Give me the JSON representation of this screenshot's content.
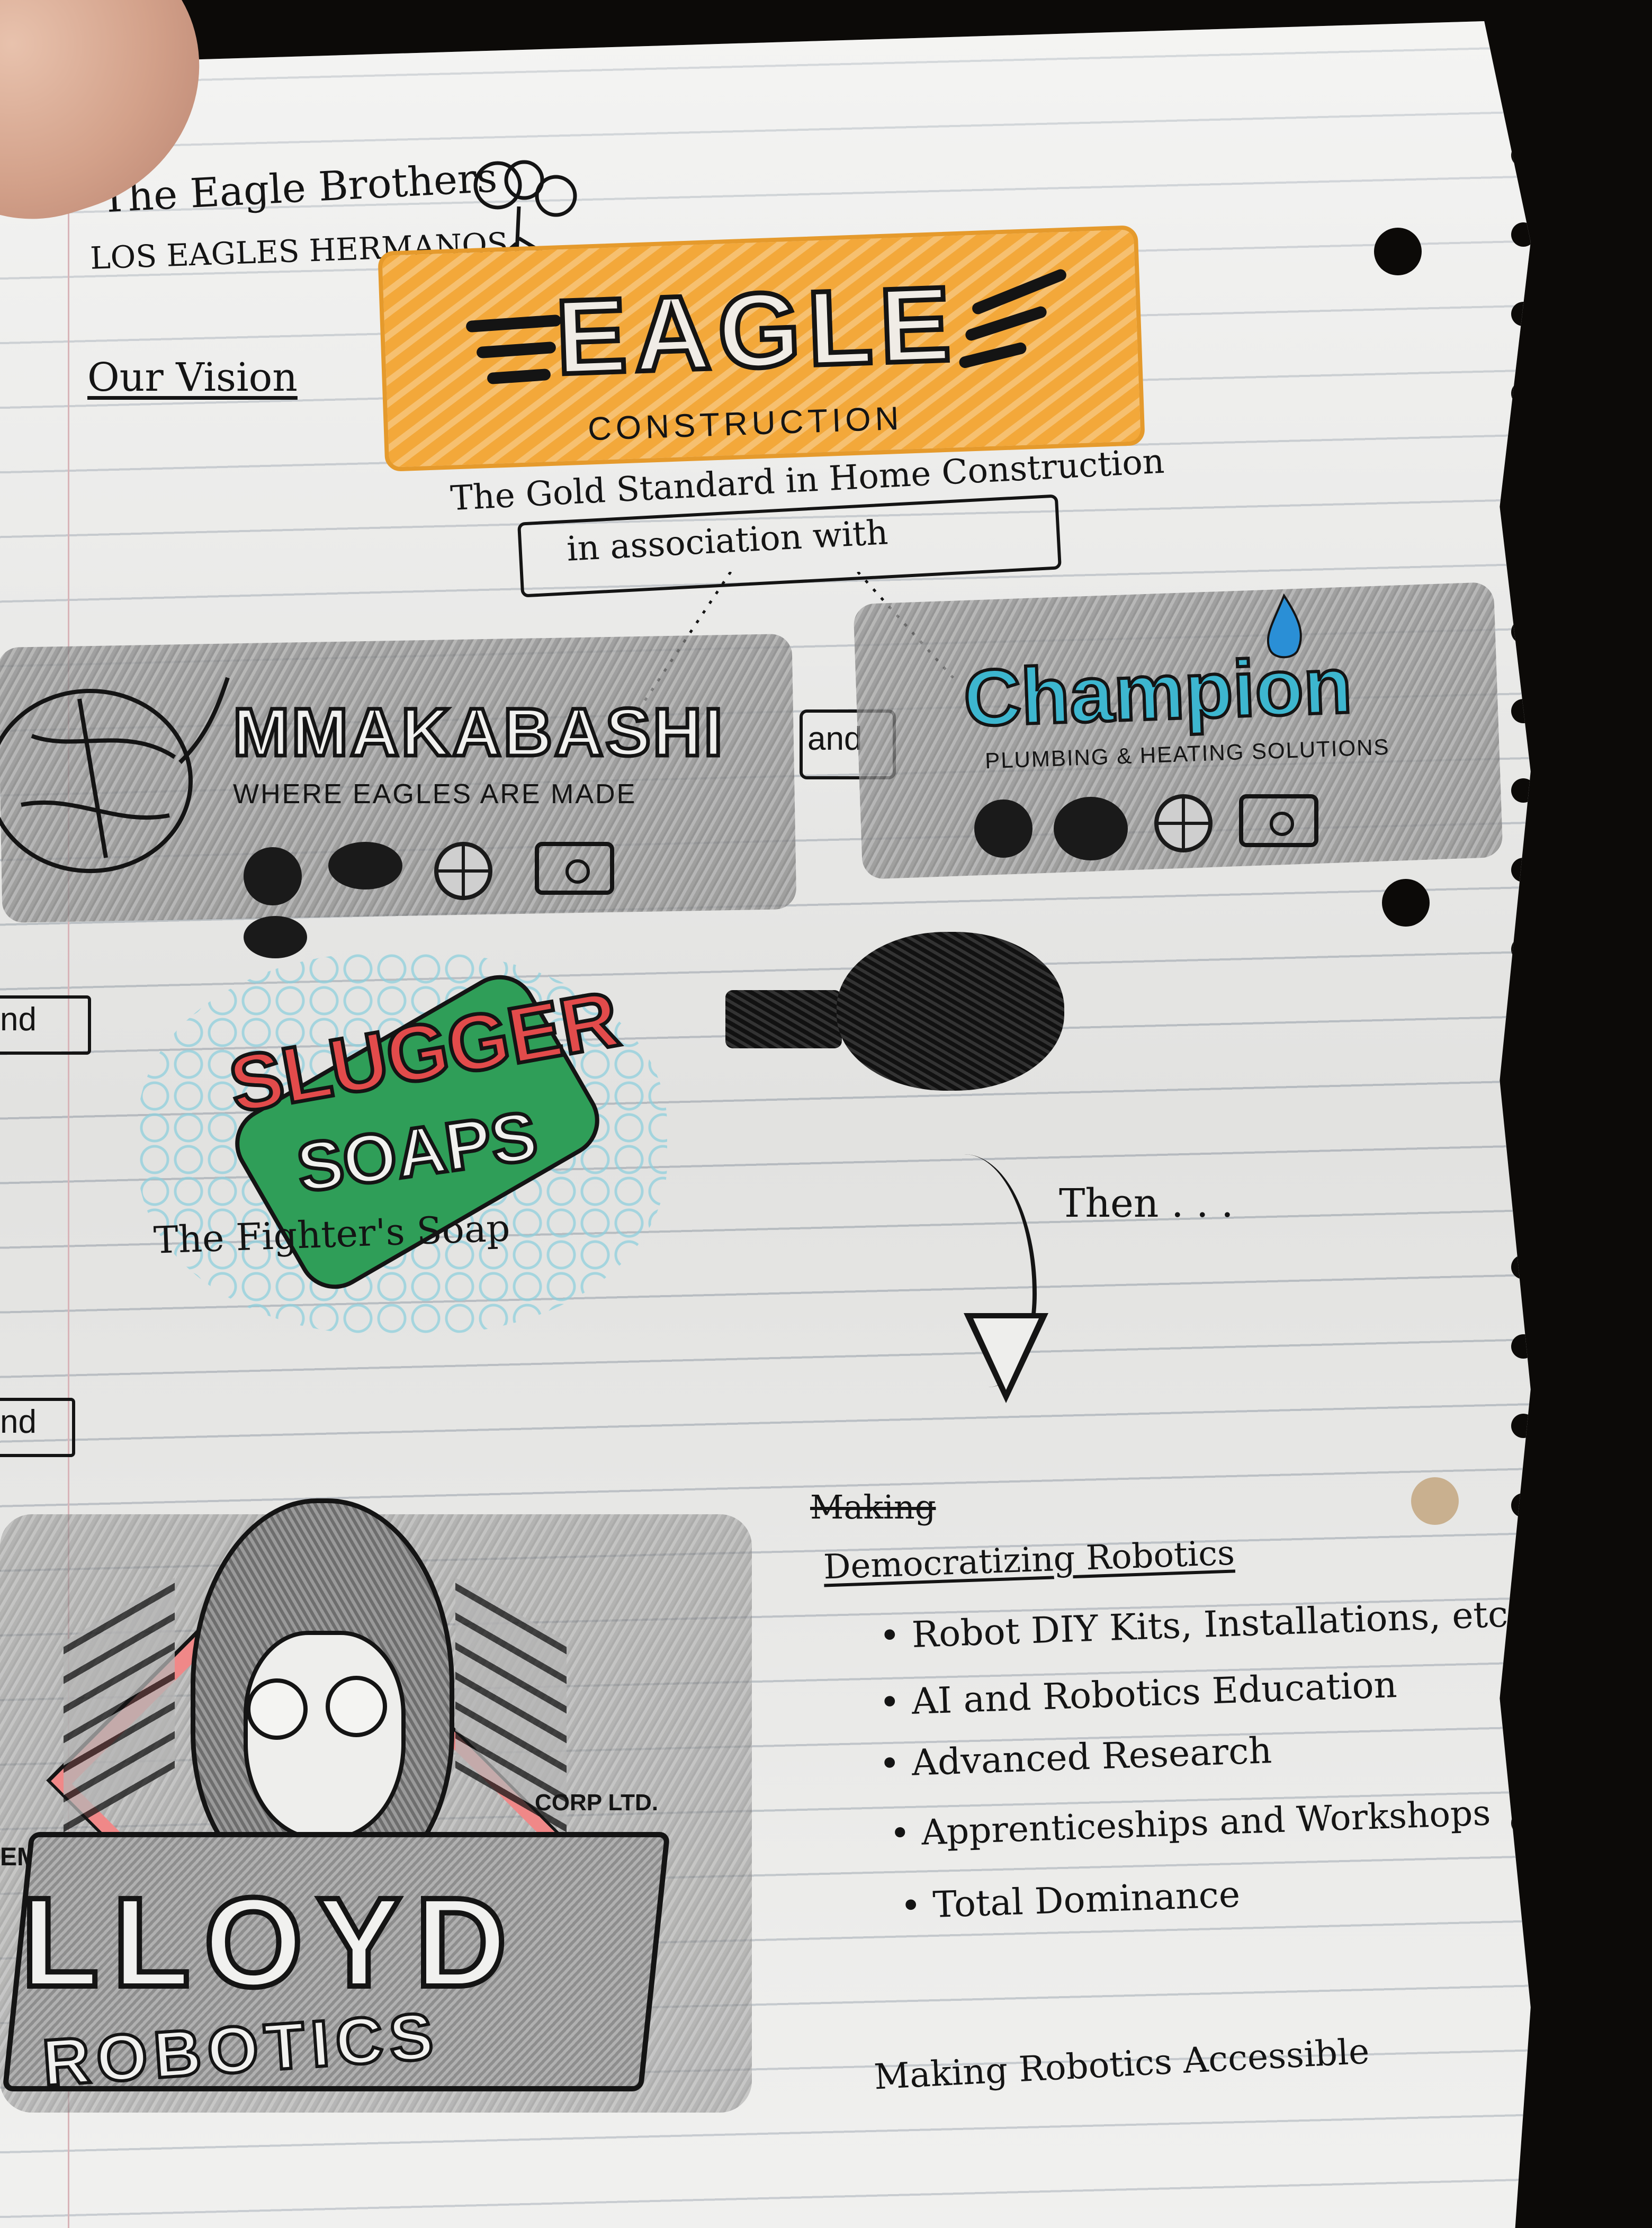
{
  "header": {
    "line1": "The Eagle Brothers",
    "line2": "LOS EAGLES HERMANOS",
    "vision_label": "Our Vision"
  },
  "eagle": {
    "name": "EAGLE",
    "sub": "CONSTRUCTION",
    "tagline": "The Gold Standard in Home Construction",
    "association": "in association with"
  },
  "mmakabashi": {
    "name": "MMAKABASHI",
    "tagline": "WHERE EAGLES ARE MADE"
  },
  "connector": "and",
  "champion": {
    "name": "Champion",
    "tagline": "PLUMBING & HEATING SOLUTIONS",
    "name_color": "#3db6cf",
    "flame_color": "#2a8fd6"
  },
  "and_left_1": "nd",
  "and_left_2": "nd",
  "slugger": {
    "name_top": "SLUGGER",
    "name_bottom": "SOAPS",
    "tagline": "The Fighter's Soap",
    "red": "#e24b4b",
    "green": "#2f9e58"
  },
  "then": "Then . . .",
  "lloyd": {
    "empire": "EMPIRE",
    "corp": "CORP LTD.",
    "name": "LLOYD",
    "robotics": "ROBOTICS"
  },
  "robotics_plan": {
    "struck": "Making",
    "heading": "Democratizing Robotics",
    "bullets": [
      "Robot DIY Kits, Installations, etc.",
      "AI and Robotics Education",
      "Advanced Research",
      "Apprenticeships and Workshops",
      "Total Dominance"
    ],
    "footer": "Making Robotics Accessible"
  },
  "colors": {
    "accent_orange": "#f3a83a",
    "pencil_gray": "#8e8e8e",
    "ink": "#141414"
  }
}
